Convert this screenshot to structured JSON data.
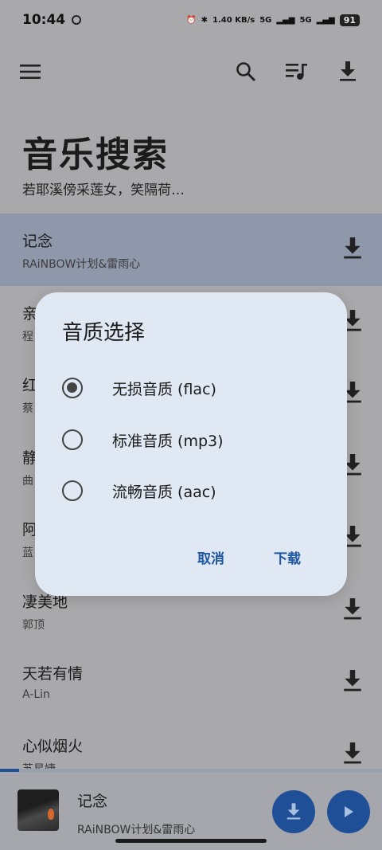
{
  "status_bar": {
    "time": "10:44",
    "speed": "1.40 KB/s",
    "network": "5G",
    "network2": "5G",
    "battery": "91"
  },
  "app_bar": {
    "menu_icon": "menu-icon",
    "search_icon": "search-icon",
    "queue_icon": "queue-music-icon",
    "download_icon": "download-icon"
  },
  "header": {
    "title": "音乐搜索",
    "subtitle": "若耶溪傍采莲女，笑隔荷…"
  },
  "songs": [
    {
      "name": "记念",
      "artist": "RAiNBOW计划&雷雨心"
    },
    {
      "name": "亲",
      "artist": "程"
    },
    {
      "name": "红",
      "artist": "蔡"
    },
    {
      "name": "静",
      "artist": "曲"
    },
    {
      "name": "阿",
      "artist": "蓝"
    },
    {
      "name": "凄美地",
      "artist": "郭顶"
    },
    {
      "name": "天若有情",
      "artist": "A-Lin"
    },
    {
      "name": "心似烟火",
      "artist": "苏星婕"
    }
  ],
  "player": {
    "name": "记念",
    "artist": "RAiNBOW计划&雷雨心",
    "progress_fraction": 0.05
  },
  "dialog": {
    "title": "音质选择",
    "options": [
      {
        "label": "无损音质 (flac)",
        "checked": true
      },
      {
        "label": "标准音质 (mp3)",
        "checked": false
      },
      {
        "label": "流畅音质 (aac)",
        "checked": false
      }
    ],
    "cancel": "取消",
    "download": "下载"
  },
  "colors": {
    "accent": "#1f4f96",
    "dialog_bg": "#e0e8f3",
    "scrim": "#a9a9ab"
  }
}
